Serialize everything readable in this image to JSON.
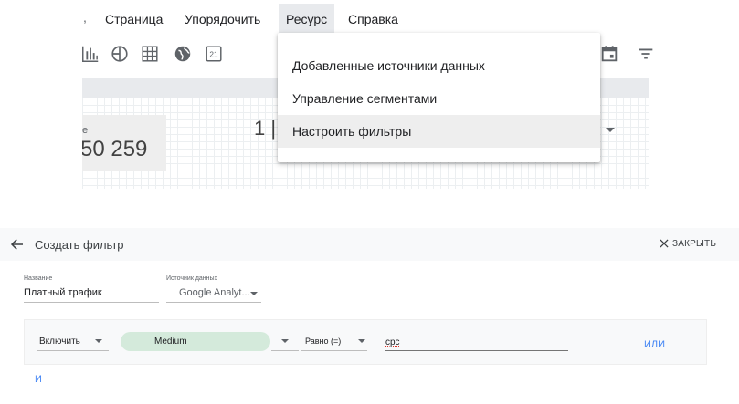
{
  "menubar": {
    "items": [
      {
        "label": "Страница"
      },
      {
        "label": "Упорядочить"
      },
      {
        "label": "Ресурс"
      },
      {
        "label": "Справка"
      }
    ]
  },
  "toolbar": {
    "icons": [
      "bar-chart-icon",
      "bullet-chart-icon",
      "table-icon",
      "geo-map-icon",
      "calendar-date-icon",
      "calendar-icon",
      "filter-lines-icon"
    ],
    "date_icon_text": "21"
  },
  "resource_menu": {
    "items": [
      {
        "label": "Добавленные источники данных"
      },
      {
        "label": "Управление сегментами"
      },
      {
        "label": "Настроить фильтры"
      }
    ]
  },
  "canvas": {
    "scorecard_label": "е",
    "scorecard_value": "50 259",
    "partial_value": "1 |"
  },
  "filter_editor": {
    "title": "Создать фильтр",
    "close_label": "ЗАКРЫТЬ",
    "name_label": "Название",
    "name_value": "Платный трафик",
    "datasource_label": "Источник данных",
    "datasource_value": "Google Analyt...",
    "clause": {
      "mode": "Включить",
      "dimension": "Medium",
      "operator": "Равно (=)",
      "value": "cpc",
      "or_label": "ИЛИ"
    },
    "and_label": "И"
  },
  "colors": {
    "accent_blue": "#4285f4",
    "chip_green": "#d4eadb",
    "menu_highlight": "#eeeeee"
  }
}
